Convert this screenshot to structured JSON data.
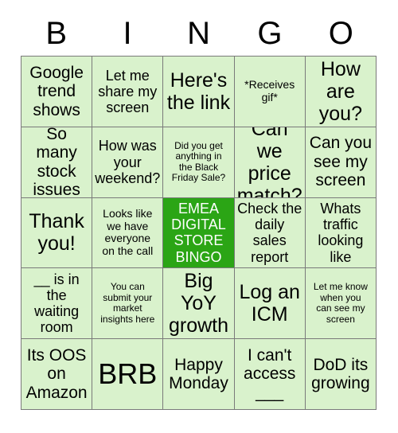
{
  "header": {
    "letters": [
      "B",
      "I",
      "N",
      "G",
      "O"
    ]
  },
  "colors": {
    "cell_background": "#d9f2cc",
    "free_space_background": "#2ba515",
    "free_space_text": "#ffffff",
    "grid_line": "#7a7a7a",
    "text": "#000000"
  },
  "grid": {
    "rows": 5,
    "columns": 5,
    "cells": [
      {
        "text": "Google\ntrend\nshows",
        "size": "lg",
        "free": false
      },
      {
        "text": "Let me\nshare my\nscreen",
        "size": "md",
        "free": false
      },
      {
        "text": "Here's\nthe link",
        "size": "xl",
        "free": false
      },
      {
        "text": "*Receives\ngif*",
        "size": "sm",
        "free": false
      },
      {
        "text": "How\nare\nyou?",
        "size": "xl",
        "free": false
      },
      {
        "text": "So many\nstock\nissues",
        "size": "lg",
        "free": false
      },
      {
        "text": "How was\nyour\nweekend?",
        "size": "md",
        "free": false
      },
      {
        "text": "Did you get\nanything in\nthe Black\nFriday Sale?",
        "size": "xs",
        "free": false
      },
      {
        "text": "Can we\nprice\nmatch?",
        "size": "xl",
        "free": false
      },
      {
        "text": "Can you\nsee my\nscreen",
        "size": "lg",
        "free": false
      },
      {
        "text": "Thank\nyou!",
        "size": "xl",
        "free": false
      },
      {
        "text": "Looks like\nwe have\neveryone\non the call",
        "size": "sm",
        "free": false
      },
      {
        "text": "EMEA\nDIGITAL\nSTORE\nBINGO",
        "size": "md",
        "free": true
      },
      {
        "text": "Check the\ndaily\nsales\nreport",
        "size": "md",
        "free": false
      },
      {
        "text": "Whats\ntraffic\nlooking\nlike",
        "size": "md",
        "free": false
      },
      {
        "text": "__ is in\nthe\nwaiting\nroom",
        "size": "md",
        "free": false
      },
      {
        "text": "You can\nsubmit your\nmarket\ninsights here",
        "size": "xs",
        "free": false
      },
      {
        "text": "Big\nYoY\ngrowth",
        "size": "xl",
        "free": false
      },
      {
        "text": "Log an\nICM",
        "size": "xl",
        "free": false
      },
      {
        "text": "Let me know\nwhen you\ncan see my\nscreen",
        "size": "xs",
        "free": false
      },
      {
        "text": "Its OOS\non\nAmazon",
        "size": "lg",
        "free": false
      },
      {
        "text": "BRB",
        "size": "huge",
        "free": false
      },
      {
        "text": "Happy\nMonday",
        "size": "lg",
        "free": false
      },
      {
        "text": "I can't\naccess\n___",
        "size": "lg",
        "free": false
      },
      {
        "text": "DoD its\ngrowing",
        "size": "lg",
        "free": false
      }
    ]
  }
}
